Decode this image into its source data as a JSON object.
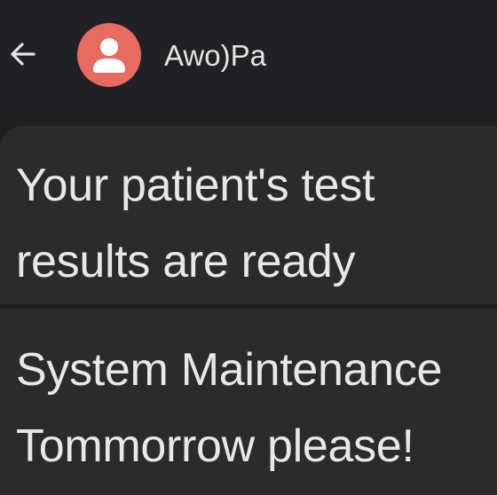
{
  "header": {
    "contact_name": "Awo)Pa",
    "back_icon": "arrow-left-icon",
    "avatar_icon": "person-icon",
    "avatar_color": "#e86b5f"
  },
  "messages": [
    {
      "lines": [
        "Your patient's test",
        "results are ready"
      ]
    },
    {
      "lines": [
        "System Maintenance",
        "Tommorrow please!"
      ]
    }
  ],
  "colors": {
    "background": "#1f1f1f",
    "app_bar": "#202124",
    "bubble": "#2b2b2b",
    "text": "#e8e8e8"
  }
}
